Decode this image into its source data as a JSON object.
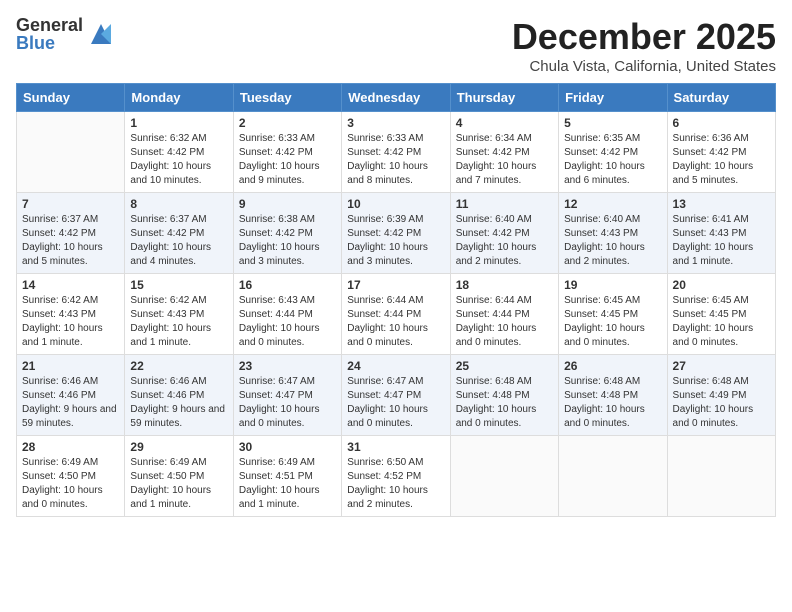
{
  "logo": {
    "general": "General",
    "blue": "Blue"
  },
  "title": "December 2025",
  "location": "Chula Vista, California, United States",
  "days_of_week": [
    "Sunday",
    "Monday",
    "Tuesday",
    "Wednesday",
    "Thursday",
    "Friday",
    "Saturday"
  ],
  "weeks": [
    [
      {
        "day": "",
        "info": ""
      },
      {
        "day": "1",
        "info": "Sunrise: 6:32 AM\nSunset: 4:42 PM\nDaylight: 10 hours and 10 minutes."
      },
      {
        "day": "2",
        "info": "Sunrise: 6:33 AM\nSunset: 4:42 PM\nDaylight: 10 hours and 9 minutes."
      },
      {
        "day": "3",
        "info": "Sunrise: 6:33 AM\nSunset: 4:42 PM\nDaylight: 10 hours and 8 minutes."
      },
      {
        "day": "4",
        "info": "Sunrise: 6:34 AM\nSunset: 4:42 PM\nDaylight: 10 hours and 7 minutes."
      },
      {
        "day": "5",
        "info": "Sunrise: 6:35 AM\nSunset: 4:42 PM\nDaylight: 10 hours and 6 minutes."
      },
      {
        "day": "6",
        "info": "Sunrise: 6:36 AM\nSunset: 4:42 PM\nDaylight: 10 hours and 5 minutes."
      }
    ],
    [
      {
        "day": "7",
        "info": "Sunrise: 6:37 AM\nSunset: 4:42 PM\nDaylight: 10 hours and 5 minutes."
      },
      {
        "day": "8",
        "info": "Sunrise: 6:37 AM\nSunset: 4:42 PM\nDaylight: 10 hours and 4 minutes."
      },
      {
        "day": "9",
        "info": "Sunrise: 6:38 AM\nSunset: 4:42 PM\nDaylight: 10 hours and 3 minutes."
      },
      {
        "day": "10",
        "info": "Sunrise: 6:39 AM\nSunset: 4:42 PM\nDaylight: 10 hours and 3 minutes."
      },
      {
        "day": "11",
        "info": "Sunrise: 6:40 AM\nSunset: 4:42 PM\nDaylight: 10 hours and 2 minutes."
      },
      {
        "day": "12",
        "info": "Sunrise: 6:40 AM\nSunset: 4:43 PM\nDaylight: 10 hours and 2 minutes."
      },
      {
        "day": "13",
        "info": "Sunrise: 6:41 AM\nSunset: 4:43 PM\nDaylight: 10 hours and 1 minute."
      }
    ],
    [
      {
        "day": "14",
        "info": "Sunrise: 6:42 AM\nSunset: 4:43 PM\nDaylight: 10 hours and 1 minute."
      },
      {
        "day": "15",
        "info": "Sunrise: 6:42 AM\nSunset: 4:43 PM\nDaylight: 10 hours and 1 minute."
      },
      {
        "day": "16",
        "info": "Sunrise: 6:43 AM\nSunset: 4:44 PM\nDaylight: 10 hours and 0 minutes."
      },
      {
        "day": "17",
        "info": "Sunrise: 6:44 AM\nSunset: 4:44 PM\nDaylight: 10 hours and 0 minutes."
      },
      {
        "day": "18",
        "info": "Sunrise: 6:44 AM\nSunset: 4:44 PM\nDaylight: 10 hours and 0 minutes."
      },
      {
        "day": "19",
        "info": "Sunrise: 6:45 AM\nSunset: 4:45 PM\nDaylight: 10 hours and 0 minutes."
      },
      {
        "day": "20",
        "info": "Sunrise: 6:45 AM\nSunset: 4:45 PM\nDaylight: 10 hours and 0 minutes."
      }
    ],
    [
      {
        "day": "21",
        "info": "Sunrise: 6:46 AM\nSunset: 4:46 PM\nDaylight: 9 hours and 59 minutes."
      },
      {
        "day": "22",
        "info": "Sunrise: 6:46 AM\nSunset: 4:46 PM\nDaylight: 9 hours and 59 minutes."
      },
      {
        "day": "23",
        "info": "Sunrise: 6:47 AM\nSunset: 4:47 PM\nDaylight: 10 hours and 0 minutes."
      },
      {
        "day": "24",
        "info": "Sunrise: 6:47 AM\nSunset: 4:47 PM\nDaylight: 10 hours and 0 minutes."
      },
      {
        "day": "25",
        "info": "Sunrise: 6:48 AM\nSunset: 4:48 PM\nDaylight: 10 hours and 0 minutes."
      },
      {
        "day": "26",
        "info": "Sunrise: 6:48 AM\nSunset: 4:48 PM\nDaylight: 10 hours and 0 minutes."
      },
      {
        "day": "27",
        "info": "Sunrise: 6:48 AM\nSunset: 4:49 PM\nDaylight: 10 hours and 0 minutes."
      }
    ],
    [
      {
        "day": "28",
        "info": "Sunrise: 6:49 AM\nSunset: 4:50 PM\nDaylight: 10 hours and 0 minutes."
      },
      {
        "day": "29",
        "info": "Sunrise: 6:49 AM\nSunset: 4:50 PM\nDaylight: 10 hours and 1 minute."
      },
      {
        "day": "30",
        "info": "Sunrise: 6:49 AM\nSunset: 4:51 PM\nDaylight: 10 hours and 1 minute."
      },
      {
        "day": "31",
        "info": "Sunrise: 6:50 AM\nSunset: 4:52 PM\nDaylight: 10 hours and 2 minutes."
      },
      {
        "day": "",
        "info": ""
      },
      {
        "day": "",
        "info": ""
      },
      {
        "day": "",
        "info": ""
      }
    ]
  ]
}
